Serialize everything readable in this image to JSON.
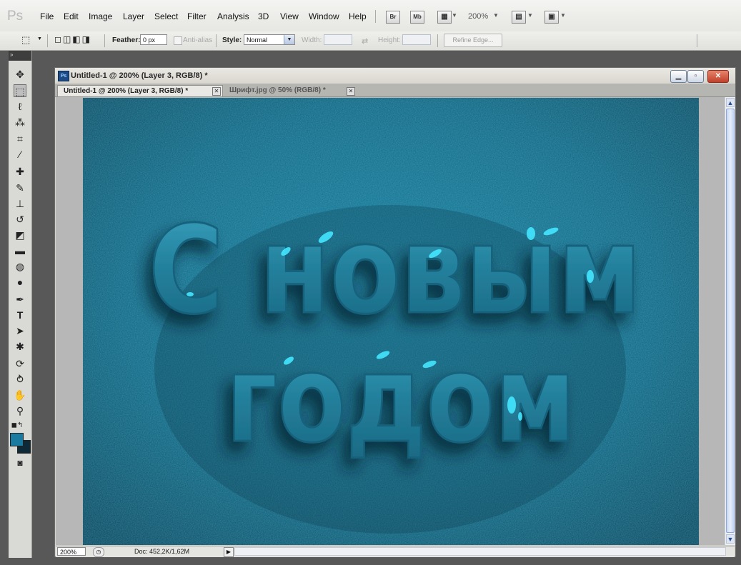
{
  "app": {
    "logo_text": "Ps",
    "menu": [
      "File",
      "Edit",
      "Image",
      "Layer",
      "Select",
      "Filter",
      "Analysis",
      "3D",
      "View",
      "Window",
      "Help"
    ],
    "bridge_label": "Br",
    "minibridge_label": "Mb",
    "zoom_dropdown": "200%"
  },
  "options_bar": {
    "feather_label": "Feather:",
    "feather_value": "0 px",
    "antialias_label": "Anti-alias",
    "style_label": "Style:",
    "style_value": "Normal",
    "width_label": "Width:",
    "height_label": "Height:",
    "refine_label": "Refine Edge..."
  },
  "toolbox": {
    "tools": [
      "move",
      "rectangular-marquee",
      "lasso",
      "quick-selection",
      "crop",
      "eyedropper",
      "spot-healing",
      "brush",
      "clone-stamp",
      "history-brush",
      "eraser",
      "gradient",
      "blur",
      "dodge",
      "pen",
      "type",
      "path-selection",
      "custom-shape",
      "3d-rotate",
      "3d-orbit",
      "hand",
      "zoom"
    ],
    "foreground_color": "#1a7aa0",
    "background_color": "#0d2a36"
  },
  "document": {
    "window_title": "Untitled-1 @ 200% (Layer 3, RGB/8) *",
    "tabs": [
      {
        "label": "Untitled-1 @ 200% (Layer 3, RGB/8) *",
        "active": true
      },
      {
        "label": "Шрифт.jpg @ 50% (RGB/8) *",
        "active": false
      }
    ],
    "canvas_text_line1": "С новым",
    "canvas_text_line2": "годом",
    "status_zoom": "200%",
    "status_doc": "Doc: 452,2K/1,62M"
  },
  "colors": {
    "canvas_base": "#0f6a86",
    "canvas_dark": "#083e52",
    "letter_fill": "#2b8aa6",
    "highlight": "#3fe4ff"
  }
}
